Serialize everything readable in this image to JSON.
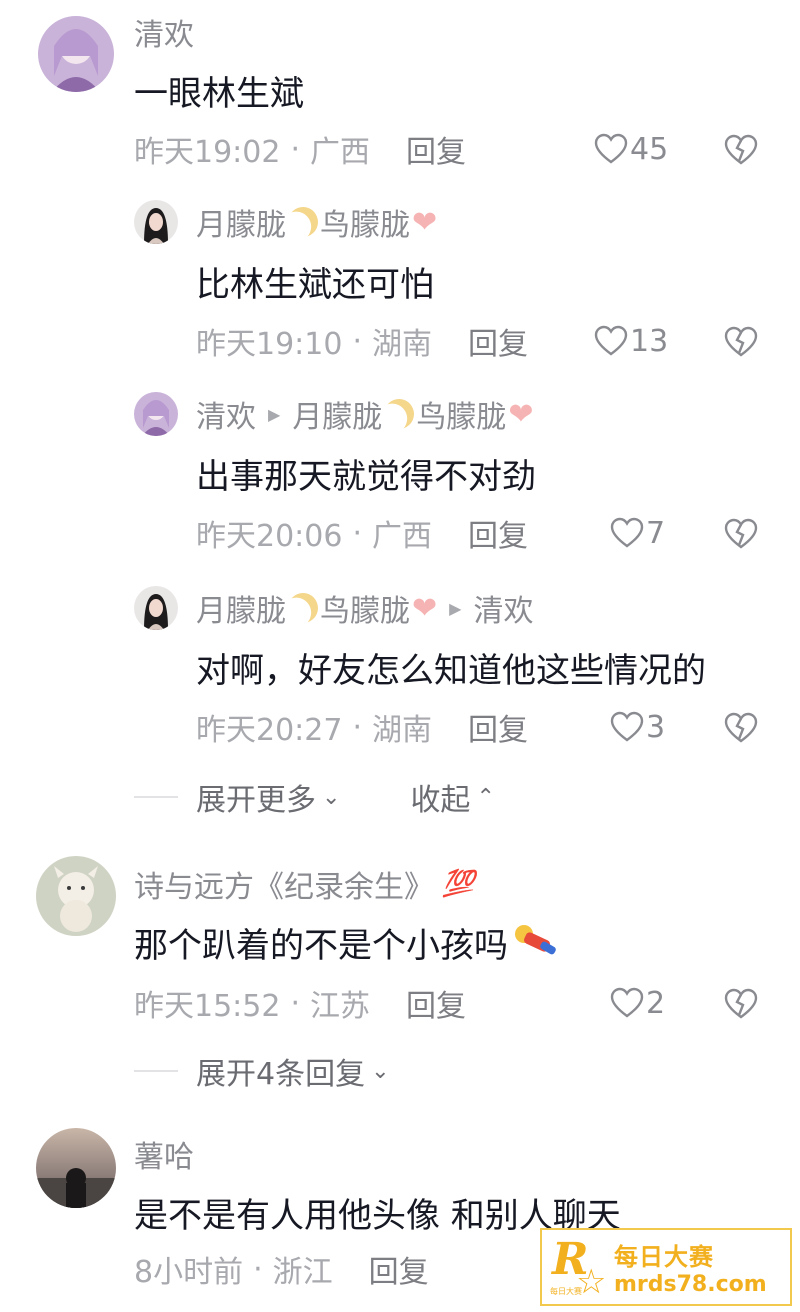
{
  "comments": [
    {
      "user": "清欢",
      "text": "一眼林生斌",
      "time": "昨天19:02",
      "region": "广西",
      "reply_label": "回复",
      "likes": "45"
    },
    {
      "user": "月朦胧",
      "user_suffix": "鸟朦胧",
      "text": "比林生斌还可怕",
      "time": "昨天19:10",
      "region": "湖南",
      "reply_label": "回复",
      "likes": "13"
    },
    {
      "user": "清欢",
      "reply_to": "月朦胧",
      "reply_to_suffix": "鸟朦胧",
      "text": "出事那天就觉得不对劲",
      "time": "昨天20:06",
      "region": "广西",
      "reply_label": "回复",
      "likes": "7"
    },
    {
      "user": "月朦胧",
      "user_suffix": "鸟朦胧",
      "reply_to": "清欢",
      "text": "对啊，好友怎么知道他这些情况的",
      "time": "昨天20:27",
      "region": "湖南",
      "reply_label": "回复",
      "likes": "3"
    },
    {
      "user": "诗与远方《纪录余生》",
      "user_badge": "💯",
      "text": "那个趴着的不是个小孩吗",
      "time": "昨天15:52",
      "region": "江苏",
      "reply_label": "回复",
      "likes": "2"
    },
    {
      "user": "薯哈",
      "text": "是不是有人用他头像 和别人聊天",
      "time": "8小时前",
      "region": "浙江",
      "reply_label": "回复"
    }
  ],
  "thread1": {
    "expand_more": "展开更多",
    "collapse": "收起"
  },
  "thread2": {
    "expand_replies": "展开4条回复"
  },
  "separator": "·",
  "watermark": {
    "title": "每日大赛",
    "url": "mrds78.com",
    "logo_letter": "R",
    "logo_small": "每日大赛"
  },
  "icons": {
    "like": "heart-outline-icon",
    "dislike": "broken-heart-icon",
    "chevron_down": "chevron-down-icon",
    "chevron_up": "chevron-up-icon",
    "reply_arrow": "triangle-right-icon"
  },
  "colors": {
    "username": "#8a8b91",
    "text": "#161823",
    "meta": "#a8a9ae",
    "watermark": "#f2b01e"
  }
}
